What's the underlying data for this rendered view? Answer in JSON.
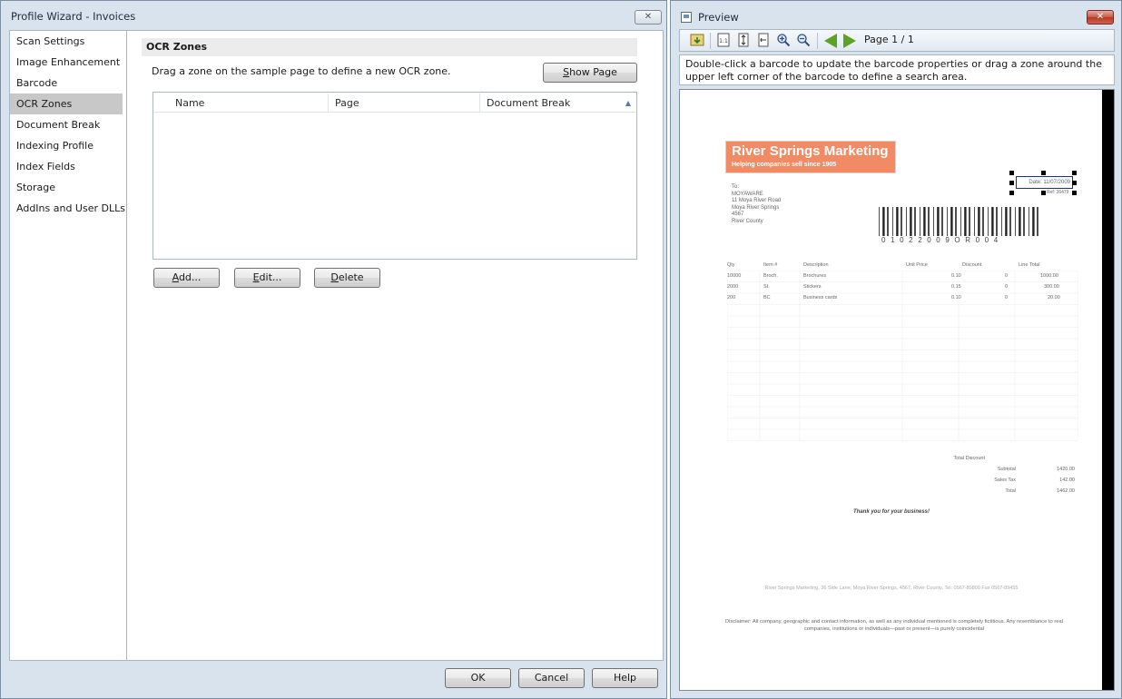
{
  "wizard": {
    "title": "Profile Wizard - Invoices",
    "close_glyph": "✕",
    "nav": [
      {
        "label": "Scan Settings"
      },
      {
        "label": "Image Enhancement"
      },
      {
        "label": "Barcode"
      },
      {
        "label": "OCR Zones",
        "active": true
      },
      {
        "label": "Document Break"
      },
      {
        "label": "Indexing Profile"
      },
      {
        "label": "Index Fields"
      },
      {
        "label": "Storage"
      },
      {
        "label": "AddIns and User DLLs"
      }
    ],
    "section_title": "OCR Zones",
    "instruction": "Drag a zone on the sample page to define a new OCR zone.",
    "show_page_mn": "S",
    "show_page_rest": "how Page",
    "table": {
      "columns": [
        "Name",
        "Page",
        "Document Break"
      ],
      "sort_glyph": "▲",
      "rows": []
    },
    "add_mn": "A",
    "add_rest": "dd...",
    "edit_mn": "E",
    "edit_rest": "dit...",
    "delete_mn": "D",
    "delete_rest": "elete",
    "ok_label": "OK",
    "cancel_label": "Cancel",
    "help_label": "Help"
  },
  "preview": {
    "title": "Preview",
    "close_glyph": "✕",
    "toolbar": {
      "one_to_one": "1:1",
      "page_indicator": "Page 1 / 1"
    },
    "hint": "Double-click a barcode to update the barcode properties or drag a zone around the upper left corner of the barcode to define a search area.",
    "document": {
      "company": "River Springs Marketing",
      "tagline": "Helping companies sell since 1905",
      "to_label": "To:",
      "address_lines": [
        "MOYAWARE",
        "11 Moya River Road",
        "Moya River Springs",
        "4567",
        "River County"
      ],
      "date": "Date: 11/07/2009",
      "ref": "Ref: 36479",
      "barcode_text": "01022009OR004",
      "columns": [
        "Qty",
        "Item #",
        "Description",
        "Unit Price",
        "Discount",
        "Line Total"
      ],
      "items": [
        {
          "qty": "10000",
          "item": "Broch.",
          "desc": "Brochures",
          "price": "0.10",
          "disc": "0",
          "total": "1000.00"
        },
        {
          "qty": "2000",
          "item": "St.",
          "desc": "Stickers",
          "price": "0.15",
          "disc": "0",
          "total": "300.00"
        },
        {
          "qty": "200",
          "item": "BC",
          "desc": "Business cards",
          "price": "0.10",
          "disc": "0",
          "total": "20.00"
        }
      ],
      "total_discount_label": "Total Discount",
      "subtotal_label": "Subtotal",
      "subtotal": "1420.00",
      "tax_label": "Sales Tax",
      "tax": "142.00",
      "total_label": "Total",
      "total": "1462.00",
      "thanks": "Thank you for your business!",
      "footer_address": "River Springs Marketing, 36 Side Lane, Moya River Springs, 4567, River County, Tel: 0567-89800 Fax 0567-89455",
      "disclaimer": "Disclaimer: All company, geographic and contact information, as well as any individual mentioned is completely fictitious. Any resemblance to real companies, institutions or individuals—past or present—is purely coincidental"
    }
  },
  "colors": {
    "window_frame": "#d8e3ee",
    "active_nav": "#c8c8c8",
    "logo_orange": "#f28a63",
    "zone_border": "#1a2f9a",
    "nav_arrows": "#5aa323"
  },
  "icons": [
    "close-icon",
    "open-image-icon",
    "actual-size-icon",
    "fit-height-icon",
    "fit-width-icon",
    "zoom-in-icon",
    "zoom-out-icon",
    "previous-page-icon",
    "next-page-icon"
  ]
}
